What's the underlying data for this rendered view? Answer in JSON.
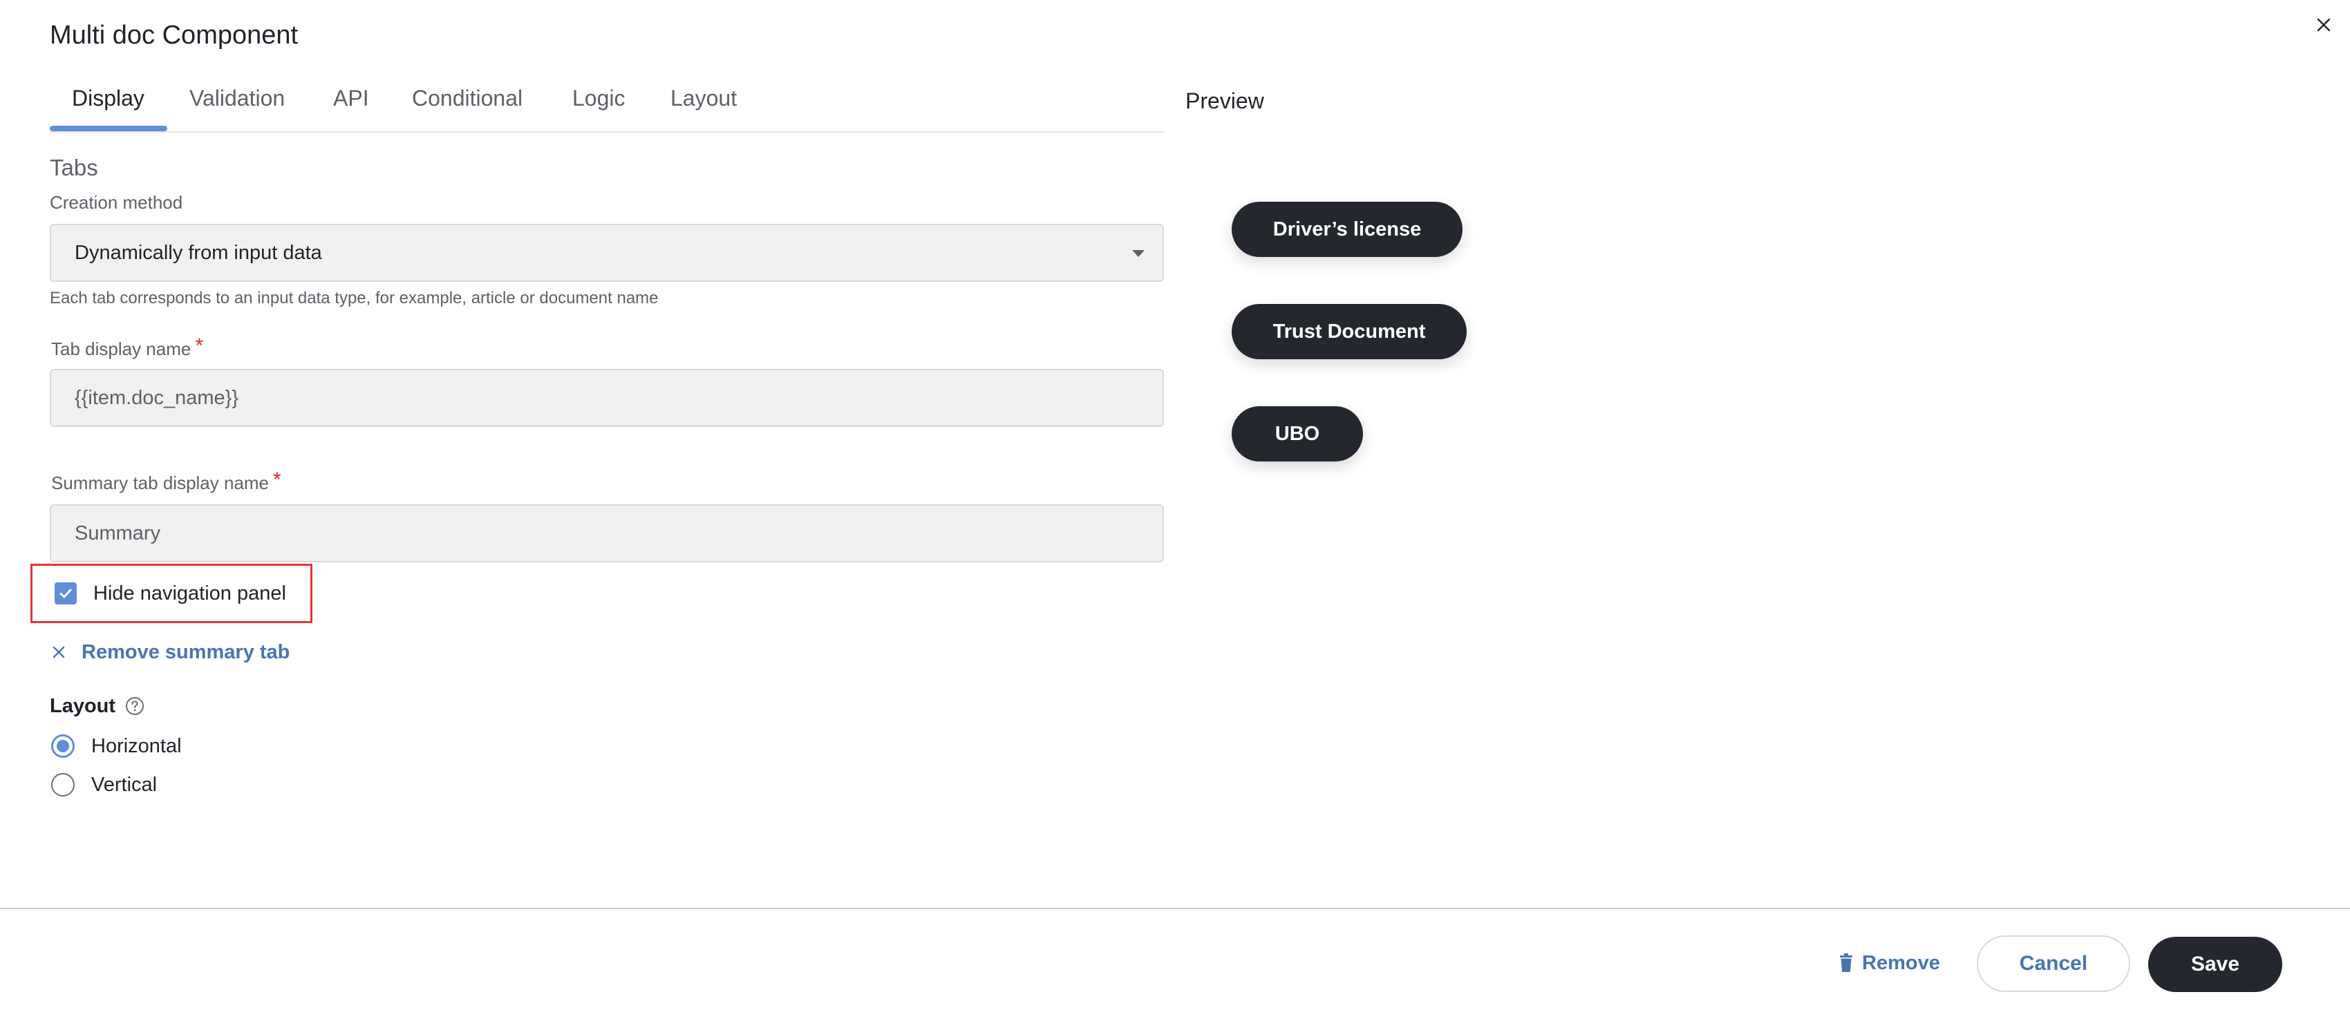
{
  "dialog": {
    "title": "Multi doc Component"
  },
  "tabs": [
    {
      "label": "Display",
      "active": true
    },
    {
      "label": "Validation"
    },
    {
      "label": "API"
    },
    {
      "label": "Conditional"
    },
    {
      "label": "Logic"
    },
    {
      "label": "Layout"
    }
  ],
  "form": {
    "section_heading": "Tabs",
    "creation_method": {
      "label": "Creation method",
      "value": "Dynamically from input data",
      "hint": "Each tab corresponds to an input data type, for example, article or document name"
    },
    "tab_display_name": {
      "label": "Tab display name",
      "required_mark": "*",
      "value": "{{item.doc_name}}"
    },
    "summary_tab_display_name": {
      "label": "Summary tab display name",
      "required_mark": "*",
      "value": "Summary"
    },
    "hide_navigation_panel": {
      "label": "Hide navigation panel",
      "checked": true
    },
    "remove_summary_tab": {
      "label": "Remove summary tab"
    },
    "layout": {
      "label": "Layout",
      "options": [
        {
          "label": "Horizontal",
          "selected": true
        },
        {
          "label": "Vertical",
          "selected": false
        }
      ]
    }
  },
  "preview": {
    "title": "Preview",
    "pills": [
      "Driver’s license",
      "Trust Document",
      "UBO"
    ]
  },
  "footer": {
    "remove_label": "Remove",
    "cancel_label": "Cancel",
    "save_label": "Save"
  },
  "colors": {
    "accent": "#5f8fd6",
    "link": "#4a74b0",
    "dark": "#24282e",
    "highlight_border": "#e0373a",
    "required": "#d62f2f"
  }
}
